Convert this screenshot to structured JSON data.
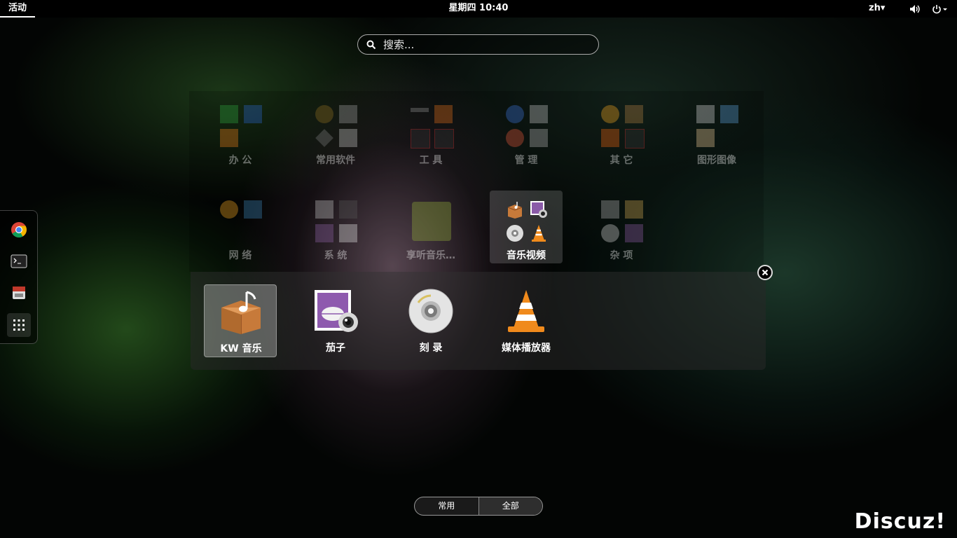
{
  "topbar": {
    "activities": "活动",
    "clock": "星期四 10:40",
    "language": "zh▾",
    "icons": [
      "volume-icon",
      "power-icon"
    ]
  },
  "search": {
    "placeholder": "搜索..."
  },
  "dash": {
    "items": [
      "chrome-icon",
      "terminal-icon",
      "file-manager-icon",
      "show-apps-icon"
    ]
  },
  "folders": [
    {
      "label": "办 公"
    },
    {
      "label": "常用软件"
    },
    {
      "label": "工 具"
    },
    {
      "label": "管 理"
    },
    {
      "label": "其 它"
    },
    {
      "label": "图形图像"
    },
    {
      "label": "网 络"
    },
    {
      "label": "系 统"
    },
    {
      "label": "享听音乐…"
    },
    {
      "label": "音乐视频",
      "active": true
    },
    {
      "label": "杂 项"
    }
  ],
  "popup": {
    "apps": [
      {
        "label": "KW 音乐",
        "icon": "music-box-icon",
        "selected": true
      },
      {
        "label": "茄子",
        "icon": "cheese-webcam-icon"
      },
      {
        "label": "刻 录",
        "icon": "disc-burner-icon"
      },
      {
        "label": "媒体播放器",
        "icon": "vlc-cone-icon"
      }
    ]
  },
  "view_toggle": {
    "left": "常用",
    "right": "全部",
    "selected": "全部"
  },
  "watermark": "Discuz!",
  "colors": {
    "accent_orange": "#f08a1c",
    "topbar": "#000000"
  }
}
